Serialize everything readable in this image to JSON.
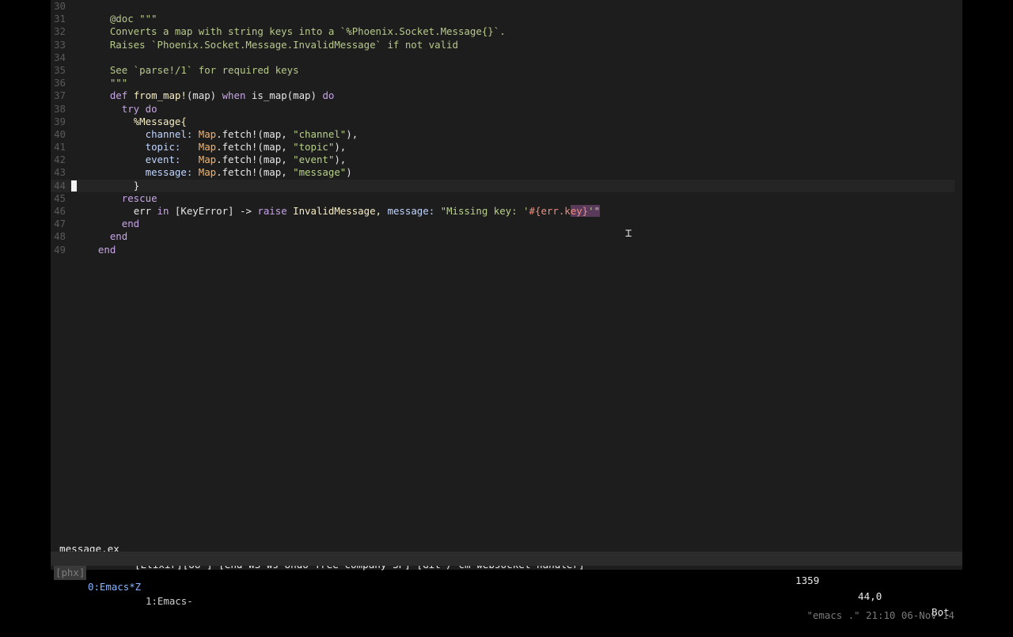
{
  "editor": {
    "lines": [
      {
        "num": "30",
        "tokens": []
      },
      {
        "num": "31",
        "tokens": [
          {
            "t": "    "
          },
          {
            "t": "@doc \"\"\"",
            "c": "t-doc"
          }
        ]
      },
      {
        "num": "32",
        "tokens": [
          {
            "t": "    "
          },
          {
            "t": "Converts a map with string keys into a `%Phoenix.Socket.Message{}`.",
            "c": "t-doc"
          }
        ]
      },
      {
        "num": "33",
        "tokens": [
          {
            "t": "    "
          },
          {
            "t": "Raises `Phoenix.Socket.Message.InvalidMessage` if not valid",
            "c": "t-doc"
          }
        ]
      },
      {
        "num": "34",
        "tokens": []
      },
      {
        "num": "35",
        "tokens": [
          {
            "t": "    "
          },
          {
            "t": "See `parse!/1` for required keys",
            "c": "t-doc"
          }
        ]
      },
      {
        "num": "36",
        "tokens": [
          {
            "t": "    "
          },
          {
            "t": "\"\"\"",
            "c": "t-doc"
          }
        ]
      },
      {
        "num": "37",
        "tokens": [
          {
            "t": "    "
          },
          {
            "t": "def ",
            "c": "t-kw"
          },
          {
            "t": "from_map!",
            "c": "t-fn"
          },
          {
            "t": "(map) ",
            "c": "t-plain"
          },
          {
            "t": "when ",
            "c": "t-kw"
          },
          {
            "t": "is_map(map) ",
            "c": "t-plain"
          },
          {
            "t": "do",
            "c": "t-kw"
          }
        ]
      },
      {
        "num": "38",
        "tokens": [
          {
            "t": "      "
          },
          {
            "t": "try do",
            "c": "t-kw"
          }
        ]
      },
      {
        "num": "39",
        "tokens": [
          {
            "t": "        "
          },
          {
            "t": "%Message{",
            "c": "t-fn"
          }
        ]
      },
      {
        "num": "40",
        "tokens": [
          {
            "t": "          "
          },
          {
            "t": "channel: ",
            "c": "t-key"
          },
          {
            "t": "Map",
            "c": "t-mod"
          },
          {
            "t": ".fetch!(map, ",
            "c": "t-plain"
          },
          {
            "t": "\"channel\"",
            "c": "t-str"
          },
          {
            "t": "),",
            "c": "t-plain"
          }
        ]
      },
      {
        "num": "41",
        "tokens": [
          {
            "t": "          "
          },
          {
            "t": "topic:   ",
            "c": "t-key"
          },
          {
            "t": "Map",
            "c": "t-mod"
          },
          {
            "t": ".fetch!(map, ",
            "c": "t-plain"
          },
          {
            "t": "\"topic\"",
            "c": "t-str"
          },
          {
            "t": "),",
            "c": "t-plain"
          }
        ]
      },
      {
        "num": "42",
        "tokens": [
          {
            "t": "          "
          },
          {
            "t": "event:   ",
            "c": "t-key"
          },
          {
            "t": "Map",
            "c": "t-mod"
          },
          {
            "t": ".fetch!(map, ",
            "c": "t-plain"
          },
          {
            "t": "\"event\"",
            "c": "t-str"
          },
          {
            "t": "),",
            "c": "t-plain"
          }
        ]
      },
      {
        "num": "43",
        "tokens": [
          {
            "t": "          "
          },
          {
            "t": "message: ",
            "c": "t-key"
          },
          {
            "t": "Map",
            "c": "t-mod"
          },
          {
            "t": ".fetch!(map, ",
            "c": "t-plain"
          },
          {
            "t": "\"message\"",
            "c": "t-str"
          },
          {
            "t": ")",
            "c": "t-plain"
          }
        ]
      },
      {
        "num": "44",
        "current": true,
        "tokens": [
          {
            "t": "        "
          },
          {
            "t": "}",
            "c": "t-plain"
          }
        ]
      },
      {
        "num": "45",
        "tokens": [
          {
            "t": "      "
          },
          {
            "t": "rescue",
            "c": "t-kw"
          }
        ]
      },
      {
        "num": "46",
        "tokens": [
          {
            "t": "        "
          },
          {
            "t": "err ",
            "c": "t-plain"
          },
          {
            "t": "in ",
            "c": "t-kw"
          },
          {
            "t": "[KeyError] -> ",
            "c": "t-plain"
          },
          {
            "t": "raise ",
            "c": "t-builtin"
          },
          {
            "t": "InvalidMessage, ",
            "c": "t-fn"
          },
          {
            "t": "message: ",
            "c": "t-key"
          },
          {
            "t": "\"Missing key: '",
            "c": "t-str"
          },
          {
            "t": "#{err.k",
            "c": "t-interp"
          },
          {
            "t": "ey}",
            "c": "t-interp t-hl"
          },
          {
            "t": "'\"",
            "c": "t-str t-hl"
          }
        ]
      },
      {
        "num": "47",
        "tokens": [
          {
            "t": "      "
          },
          {
            "t": "end",
            "c": "t-kw"
          }
        ]
      },
      {
        "num": "48",
        "tokens": [
          {
            "t": "    "
          },
          {
            "t": "end",
            "c": "t-kw"
          }
        ]
      },
      {
        "num": "49",
        "tokens": [
          {
            "t": "  "
          },
          {
            "t": "end",
            "c": "t-kw"
          }
        ]
      }
    ]
  },
  "modeline": {
    "filename": "message.ex",
    "modes": "[Elixir][UU-] [end WS ws Undo-Tree company SP] [Git / cm-websocket-handler]",
    "size": "1359",
    "position": "44,0",
    "scroll": "Bot"
  },
  "tmux": {
    "session": "[phx]",
    "window0": "0:Emacs*Z",
    "window1": "1:Emacs-",
    "right": "\"emacs .\" 21:10 06-Nov-14"
  },
  "pointer": {
    "glyph": "⌶"
  }
}
